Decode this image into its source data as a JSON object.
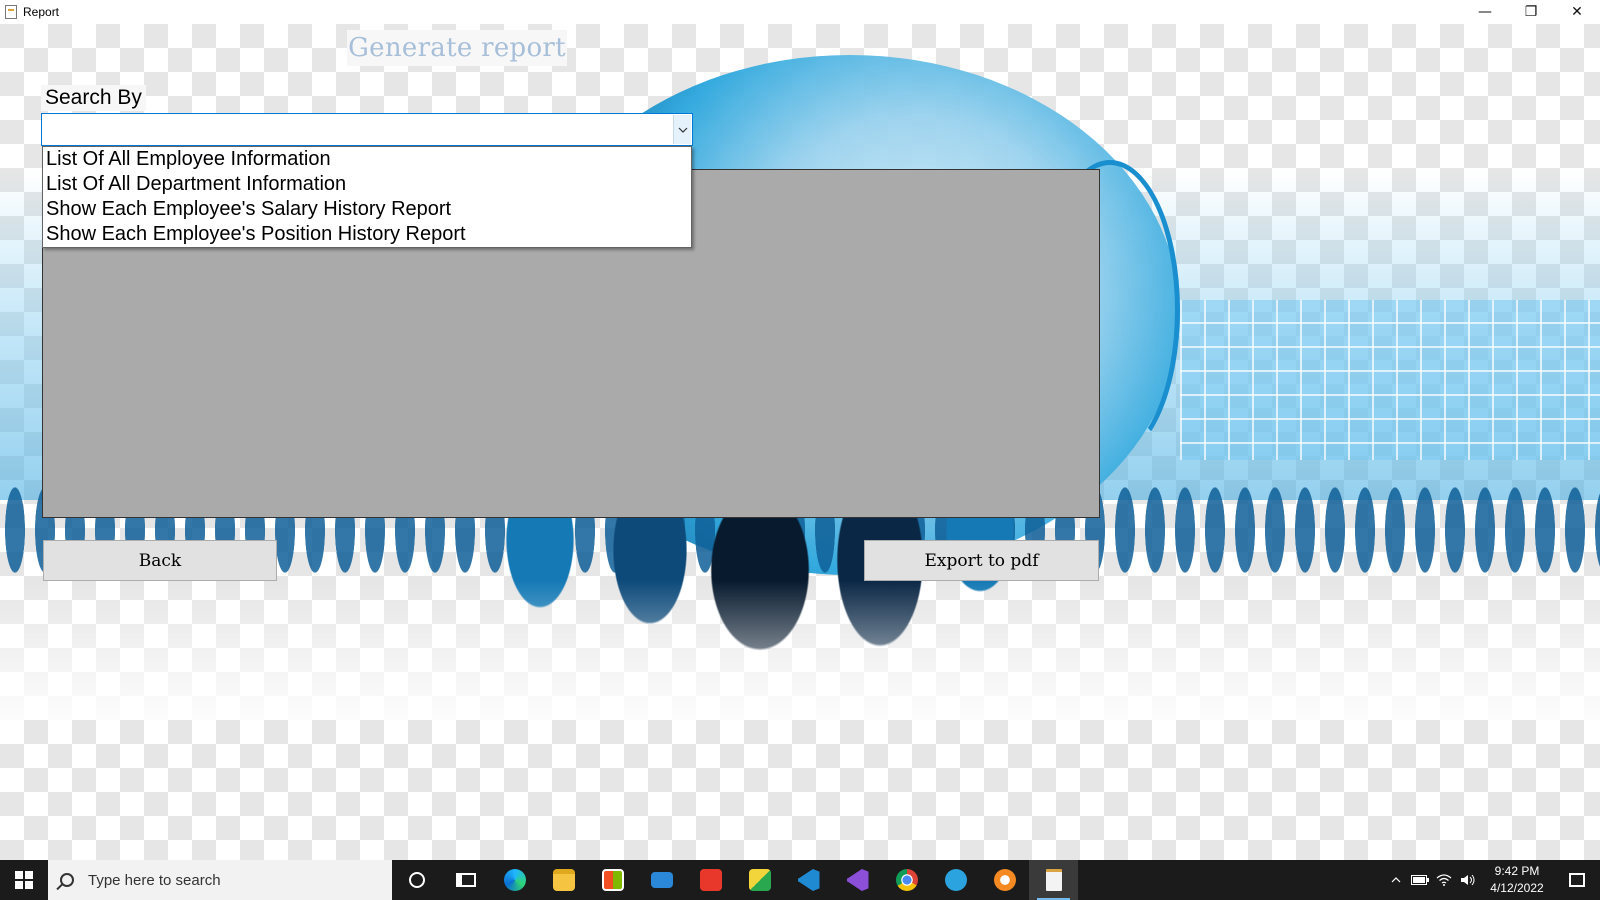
{
  "window": {
    "title": "Report",
    "controls": {
      "minimize": "—",
      "restore": "❐",
      "close": "✕"
    }
  },
  "form": {
    "title": "Generate report",
    "search_label": "Search By",
    "combo_value": "",
    "dropdown_options": [
      "List Of All Employee Information",
      "List Of All Department Information",
      "Show Each Employee's Salary History Report",
      "Show Each Employee's Position History Report"
    ],
    "back_label": "Back",
    "export_label": "Export to pdf"
  },
  "taskbar": {
    "search_placeholder": "Type here to search",
    "apps": [
      "edge-icon",
      "file-explorer-icon",
      "store-icon",
      "mail-icon",
      "wps-office-icon",
      "sticky-app-icon",
      "vscode-icon",
      "visual-studio-icon",
      "chrome-icon",
      "telegram-icon",
      "brave-icon",
      "report-app-icon"
    ],
    "time": "9:42 PM",
    "date": "4/12/2022"
  },
  "colors": {
    "title_text": "#a7bfd8",
    "report_area": "#aaaaaa",
    "combo_border": "#0078d7",
    "taskbar": "#1b1b1b"
  }
}
